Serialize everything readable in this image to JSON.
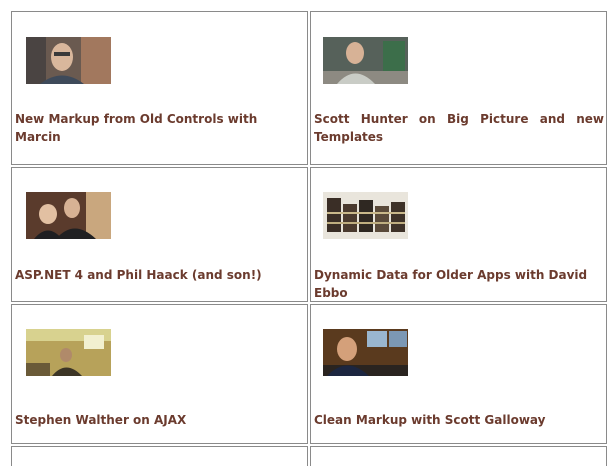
{
  "colors": {
    "link": "#6b3b2e",
    "border": "#8a8a8a"
  },
  "videos": [
    {
      "title": "New Markup from Old Controls with Marcin",
      "thumb": "person-webcam-thumbnail"
    },
    {
      "title": "Scott Hunter on  Big Picture and new Templates",
      "thumb": "person-at-desk-thumbnail"
    },
    {
      "title": "ASP.NET 4 and Phil Haack (and son!)",
      "thumb": "man-with-child-thumbnail"
    },
    {
      "title": "Dynamic Data for Older Apps with David Ebbo",
      "thumb": "book-stack-thumbnail"
    },
    {
      "title": "Stephen Walther on AJAX",
      "thumb": "office-room-thumbnail"
    },
    {
      "title": "Clean Markup with Scott Galloway",
      "thumb": "man-with-monitors-thumbnail"
    }
  ]
}
